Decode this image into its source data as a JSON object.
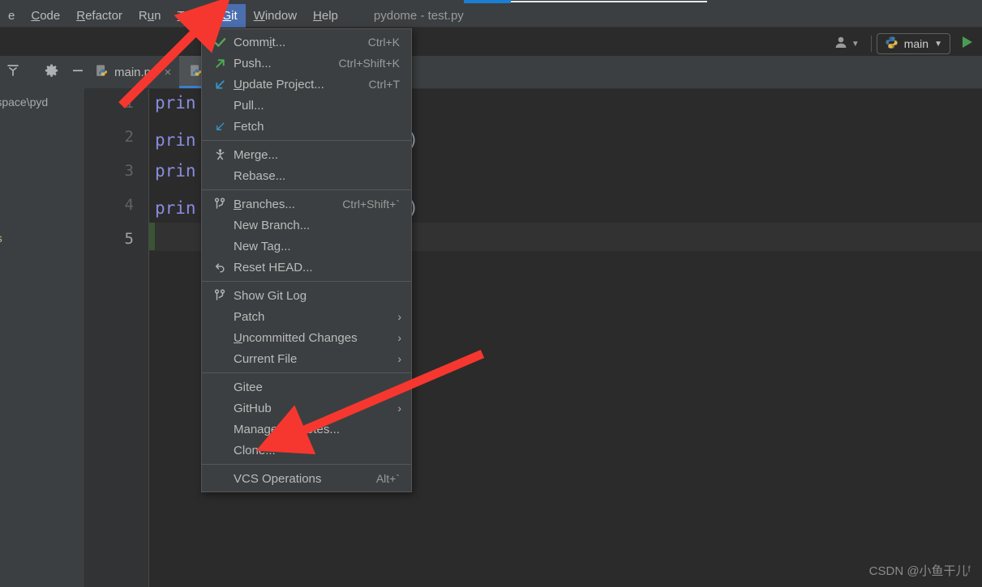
{
  "window": {
    "title": "pydome - test.py",
    "accent_blue": "#4b6eaf",
    "menu_bg": "#3c3f41",
    "editor_bg": "#2b2b2b",
    "annotation_red": "#f6372f"
  },
  "menubar": {
    "items": [
      {
        "label": "e",
        "mnemonic": "",
        "selected": false
      },
      {
        "label": "Code",
        "mnemonic": "C",
        "selected": false
      },
      {
        "label": "Refactor",
        "mnemonic": "R",
        "selected": false
      },
      {
        "label": "Run",
        "mnemonic": "u",
        "selected": false
      },
      {
        "label": "Tools",
        "mnemonic": "T",
        "selected": false
      },
      {
        "label": "Git",
        "mnemonic": "G",
        "selected": true
      },
      {
        "label": "Window",
        "mnemonic": "W",
        "selected": false
      },
      {
        "label": "Help",
        "mnemonic": "H",
        "selected": false
      }
    ]
  },
  "toolbar": {
    "avatar_icon": "user-icon",
    "avatar_caret": "▼",
    "run_config_icon": "python-icon",
    "run_config_label": "main",
    "run_config_caret": "▼",
    "run_button_icon": "play-icon"
  },
  "left_tools": {
    "collapse_icon": "collapse-all-icon",
    "settings_icon": "gear-icon",
    "hide_icon": "minimize-icon"
  },
  "left_panel": {
    "path_text": "ork space\\pyd",
    "files_text": "es"
  },
  "tabs": {
    "items": [
      {
        "label": "main.py",
        "icon": "python-file-icon",
        "active": false,
        "closable": true
      },
      {
        "label": "",
        "icon": "python-file-icon",
        "active": true,
        "closable": false
      }
    ]
  },
  "editor": {
    "lines": [
      {
        "number": "1",
        "code_prefix": "prin",
        "code_tail": "",
        "current": false
      },
      {
        "number": "2",
        "code_prefix": "prin",
        "code_tail": "容\")",
        "current": false
      },
      {
        "number": "3",
        "code_prefix": "prin",
        "code_tail": "",
        "current": false
      },
      {
        "number": "4",
        "code_prefix": "prin",
        "code_tail": "交\")",
        "current": false
      },
      {
        "number": "5",
        "code_prefix": "",
        "code_tail": "",
        "current": true
      }
    ]
  },
  "git_menu": {
    "items": [
      {
        "type": "item",
        "icon": "check-icon",
        "label": "Commit...",
        "mnemonic": "i",
        "shortcut": "Ctrl+K",
        "submenu": false
      },
      {
        "type": "item",
        "icon": "arrow-up-right-icon",
        "label": "Push...",
        "mnemonic": "",
        "shortcut": "Ctrl+Shift+K",
        "submenu": false
      },
      {
        "type": "item",
        "icon": "arrow-down-left-icon",
        "label": "Update Project...",
        "mnemonic": "U",
        "shortcut": "Ctrl+T",
        "submenu": false
      },
      {
        "type": "item",
        "icon": "",
        "label": "Pull...",
        "mnemonic": "",
        "shortcut": "",
        "submenu": false
      },
      {
        "type": "item",
        "icon": "fetch-icon",
        "label": "Fetch",
        "mnemonic": "",
        "shortcut": "",
        "submenu": false
      },
      {
        "type": "separator"
      },
      {
        "type": "item",
        "icon": "merge-icon",
        "label": "Merge...",
        "mnemonic": "",
        "shortcut": "",
        "submenu": false
      },
      {
        "type": "item",
        "icon": "",
        "label": "Rebase...",
        "mnemonic": "",
        "shortcut": "",
        "submenu": false
      },
      {
        "type": "separator"
      },
      {
        "type": "item",
        "icon": "branch-icon",
        "label": "Branches...",
        "mnemonic": "B",
        "shortcut": "Ctrl+Shift+`",
        "submenu": false
      },
      {
        "type": "item",
        "icon": "",
        "label": "New Branch...",
        "mnemonic": "",
        "shortcut": "",
        "submenu": false
      },
      {
        "type": "item",
        "icon": "",
        "label": "New Tag...",
        "mnemonic": "",
        "shortcut": "",
        "submenu": false
      },
      {
        "type": "item",
        "icon": "reset-icon",
        "label": "Reset HEAD...",
        "mnemonic": "",
        "shortcut": "",
        "submenu": false
      },
      {
        "type": "separator"
      },
      {
        "type": "item",
        "icon": "branch-icon",
        "label": "Show Git Log",
        "mnemonic": "",
        "shortcut": "",
        "submenu": false
      },
      {
        "type": "item",
        "icon": "",
        "label": "Patch",
        "mnemonic": "",
        "shortcut": "",
        "submenu": true
      },
      {
        "type": "item",
        "icon": "",
        "label": "Uncommitted Changes",
        "mnemonic": "U",
        "shortcut": "",
        "submenu": true
      },
      {
        "type": "item",
        "icon": "",
        "label": "Current File",
        "mnemonic": "",
        "shortcut": "",
        "submenu": true
      },
      {
        "type": "separator"
      },
      {
        "type": "item",
        "icon": "",
        "label": "Gitee",
        "mnemonic": "",
        "shortcut": "",
        "submenu": true
      },
      {
        "type": "item",
        "icon": "",
        "label": "GitHub",
        "mnemonic": "",
        "shortcut": "",
        "submenu": true
      },
      {
        "type": "item",
        "icon": "",
        "label": "Manage Remotes...",
        "mnemonic": "",
        "shortcut": "",
        "submenu": false
      },
      {
        "type": "item",
        "icon": "",
        "label": "Clone...",
        "mnemonic": "",
        "shortcut": "",
        "submenu": false
      },
      {
        "type": "separator"
      },
      {
        "type": "item",
        "icon": "",
        "label": "VCS Operations",
        "mnemonic": "",
        "shortcut": "Alt+`",
        "submenu": false
      }
    ]
  },
  "annotations": {
    "arrow_1_name": "red-arrow-to-git-menu",
    "arrow_2_name": "red-arrow-to-clone"
  },
  "watermark": {
    "text": "CSDN @小鱼干儿ᶠ"
  }
}
